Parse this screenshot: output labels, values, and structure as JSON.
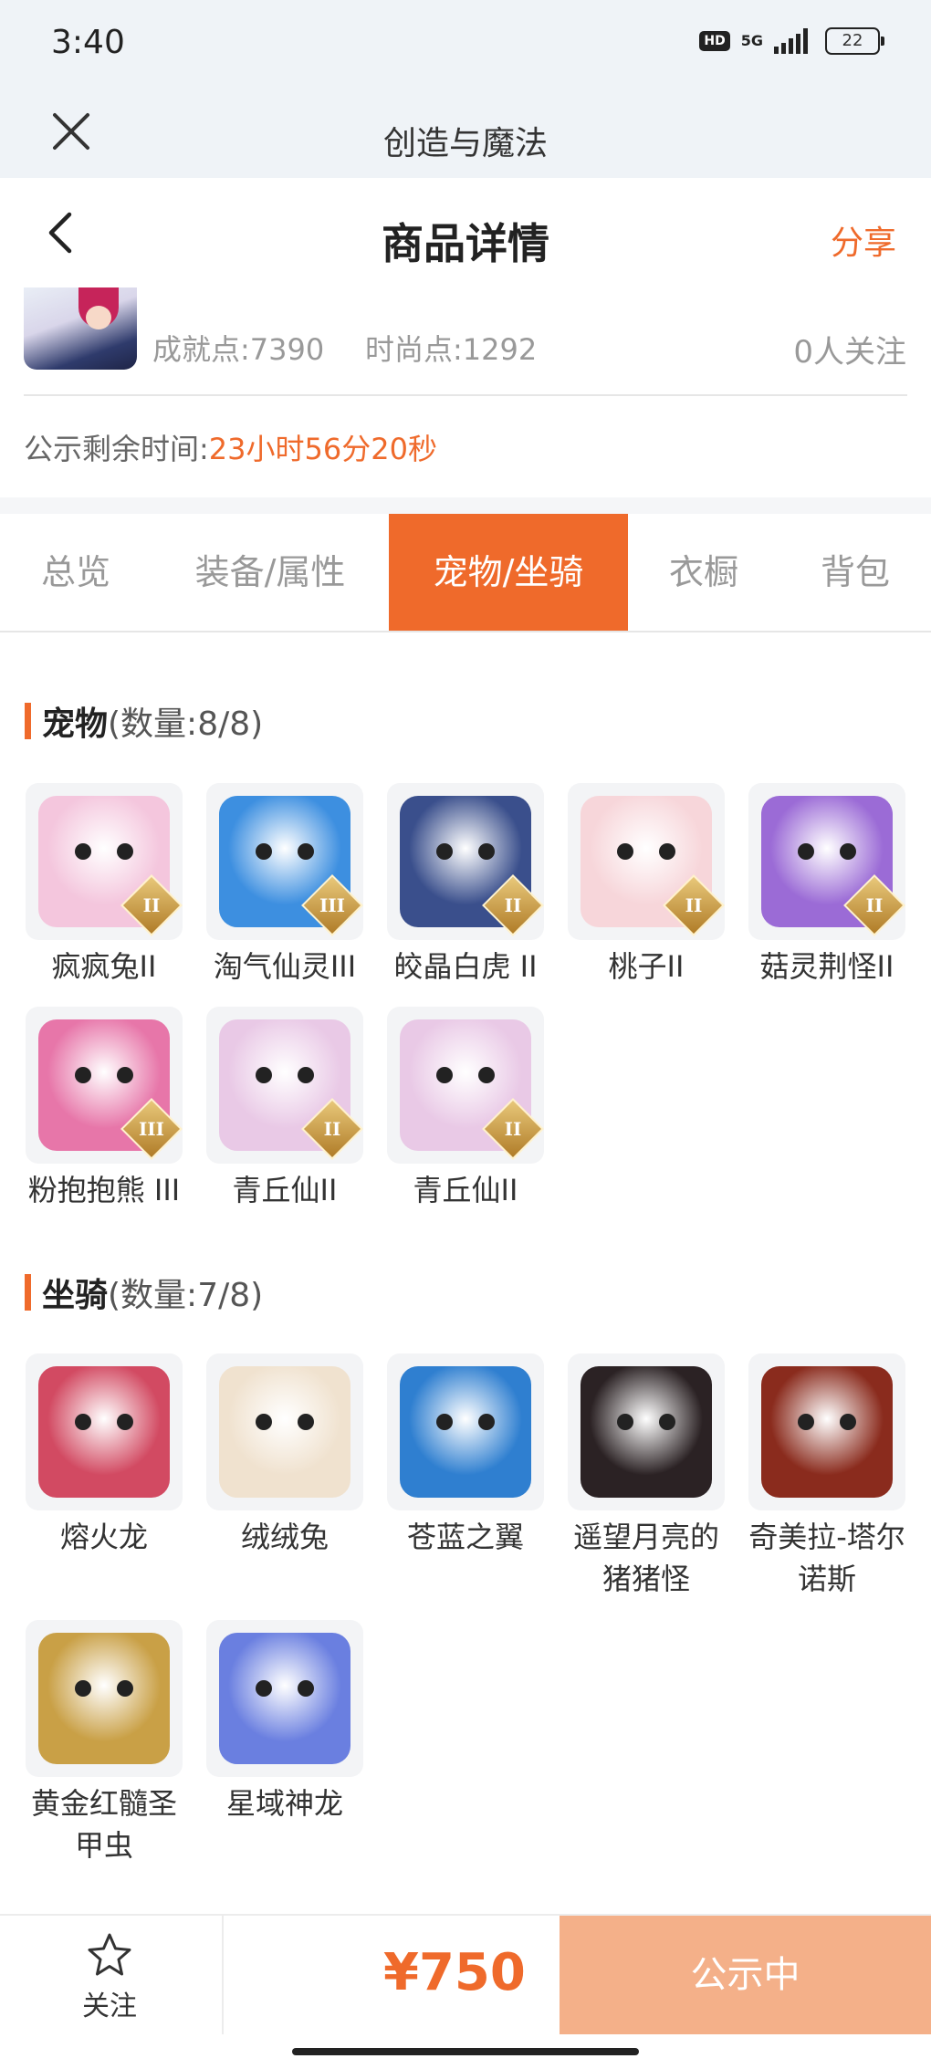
{
  "status_bar": {
    "time": "3:40",
    "hd": "HD",
    "network": "5G",
    "battery": "22"
  },
  "app_bar": {
    "title": "创造与魔法"
  },
  "header": {
    "title": "商品详情",
    "share": "分享"
  },
  "summary": {
    "achievement": "成就点:7390",
    "fashion": "时尚点:1292",
    "followers": "0人关注",
    "countdown_label": "公示剩余时间:",
    "countdown_value": "23小时56分20秒"
  },
  "tabs": [
    {
      "label": "总览"
    },
    {
      "label": "装备/属性"
    },
    {
      "label": "宠物/坐骑",
      "active": true
    },
    {
      "label": "衣橱"
    },
    {
      "label": "背包"
    }
  ],
  "pets": {
    "title": "宠物",
    "count": "(数量:8/8)",
    "items": [
      {
        "name": "疯疯兔II",
        "grade": "II",
        "color": "#f4c6dd"
      },
      {
        "name": "淘气仙灵III",
        "grade": "III",
        "color": "#3d8fe0"
      },
      {
        "name": "皎晶白虎 II",
        "grade": "II",
        "color": "#3a4f8c"
      },
      {
        "name": "桃子II",
        "grade": "II",
        "color": "#f7d6da"
      },
      {
        "name": "菇灵荆怪II",
        "grade": "II",
        "color": "#9b6bd6"
      },
      {
        "name": "粉抱抱熊 III",
        "grade": "III",
        "color": "#e776a9"
      },
      {
        "name": "青丘仙II",
        "grade": "II",
        "color": "#e9c9e6"
      },
      {
        "name": "青丘仙II",
        "grade": "II",
        "color": "#e9c9e6"
      }
    ]
  },
  "mounts": {
    "title": "坐骑",
    "count": "(数量:7/8)",
    "items": [
      {
        "name": "熔火龙",
        "color": "#d24a62"
      },
      {
        "name": "绒绒兔",
        "color": "#f0e2cf"
      },
      {
        "name": "苍蓝之翼",
        "color": "#2f7fd0"
      },
      {
        "name": "遥望月亮的猪猪怪",
        "color": "#2b2224"
      },
      {
        "name": "奇美拉-塔尔诺斯",
        "color": "#8a2b1d"
      },
      {
        "name": "黄金红髓圣甲虫",
        "color": "#c9a046"
      },
      {
        "name": "星域神龙",
        "color": "#6a7fe0"
      }
    ]
  },
  "bottom_bar": {
    "follow": "关注",
    "price": "¥750",
    "status": "公示中"
  }
}
